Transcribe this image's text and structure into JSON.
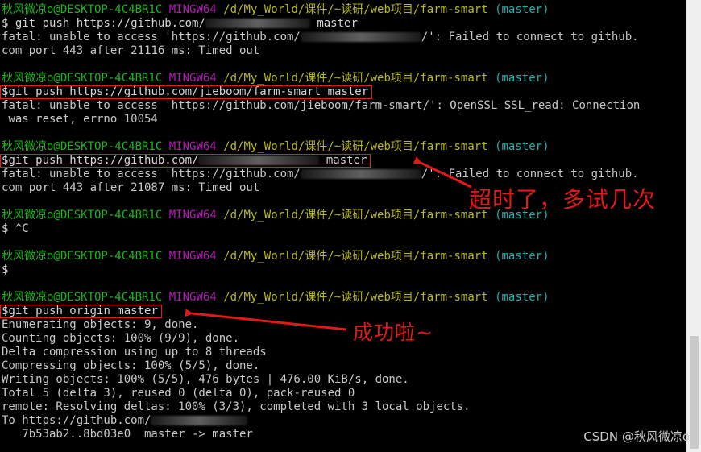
{
  "prompt": {
    "user": "秋风微凉o@DESKTOP-4C4BR1C",
    "shell": "MINGW64",
    "path": "/d/My_World/课件/~读研/web项目/farm-smart",
    "branch": "(master)",
    "symbol": "$"
  },
  "blocks": [
    {
      "command_pre": "git push https://github.com/",
      "command_post": " master",
      "output": [
        "fatal: unable to access 'https://github.com/",
        "/': Failed to connect to github.",
        "com port 443 after 21116 ms: Timed out"
      ]
    },
    {
      "command": "git push https://github.com/jieboom/farm-smart master",
      "output": [
        "fatal: unable to access 'https://github.com/jieboom/farm-smart/': OpenSSL SSL_read: Connection",
        " was reset, errno 10054"
      ]
    },
    {
      "command_pre": "git push https://github.com/",
      "command_post": " master",
      "output": [
        "fatal: unable to access 'https://github.com/",
        "/': Failed to connect to github.",
        "com port 443 after 21087 ms: Timed out"
      ]
    },
    {
      "command": "^C"
    },
    {
      "command": ""
    },
    {
      "command": "git push origin master",
      "output": [
        "Enumerating objects: 9, done.",
        "Counting objects: 100% (9/9), done.",
        "Delta compression using up to 8 threads",
        "Compressing objects: 100% (5/5), done.",
        "Writing objects: 100% (5/5), 476 bytes | 476.00 KiB/s, done.",
        "Total 5 (delta 3), reused 0 (delta 0), pack-reused 0",
        "remote: Resolving deltas: 100% (3/3), completed with 3 local objects.",
        "To https://github.com/",
        "   7b53ab2..8bd03e0  master -> master"
      ]
    }
  ],
  "annotations": {
    "timeout_note": "超时了，多试几次",
    "success_note": "成功啦~",
    "color": "#e01919"
  },
  "watermark": "CSDN @秋风微凉o",
  "colors": {
    "user": "#1cb51c",
    "shell": "#b21cb2",
    "path": "#b8b81c",
    "branch": "#1cb1b1",
    "highlight": "#e11d1d"
  }
}
